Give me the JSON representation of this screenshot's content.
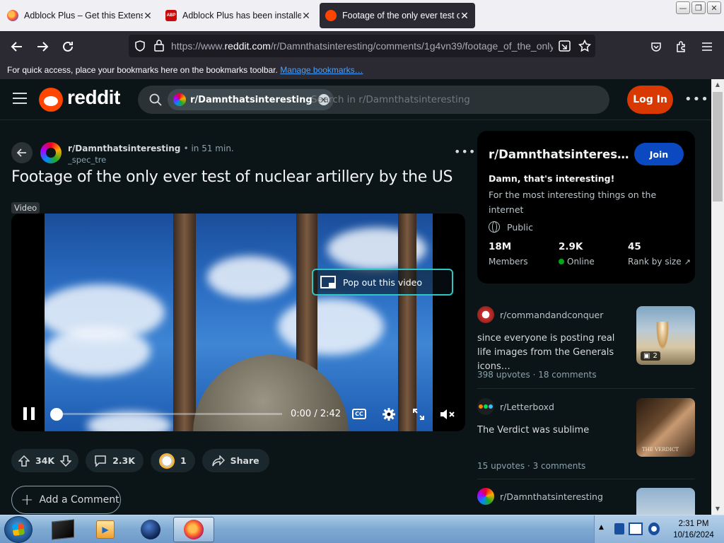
{
  "browser": {
    "tabs": [
      {
        "title": "Adblock Plus – Get this Extensio",
        "favicon": "firefox-icon",
        "active": false
      },
      {
        "title": "Adblock Plus has been installed!",
        "favicon": "abp-icon",
        "active": false
      },
      {
        "title": "Footage of the only ever test of",
        "favicon": "reddit-icon",
        "active": true
      }
    ],
    "favicon_abp_text": "ABP",
    "url_prefix": "https://www.",
    "url_host": "reddit.com",
    "url_path": "/r/Damnthatsinteresting/comments/1g4vn39/footage_of_the_only",
    "bookmarks_text": "For quick access, place your bookmarks here on the bookmarks toolbar.",
    "bookmarks_link": "Manage bookmarks…"
  },
  "reddit_header": {
    "logo_text": "reddit",
    "search_chip": "r/Damnthatsinteresting",
    "search_placeholder": "Search in r/Damnthatsinteresting",
    "login_label": "Log In",
    "more_label": "•••"
  },
  "post": {
    "subreddit": "r/Damnthatsinteresting",
    "time": "• in 51 min.",
    "author": "_spec_tre",
    "title": "Footage of the only ever test of nuclear artillery by the US",
    "flair": "Video",
    "more_label": "•••",
    "video": {
      "popout_label": "Pop out this video",
      "time": "0:00 / 2:42",
      "cc_label": "CC",
      "progress": 0
    },
    "actions": {
      "upvotes": "34K",
      "comments": "2.3K",
      "awards": "1",
      "share": "Share"
    },
    "add_comment": "Add a Comment"
  },
  "sidebar": {
    "title": "r/Damnthatsinteresting",
    "join_label": "Join",
    "tagline": "Damn, that's interesting!",
    "description": "For the most interesting things on the internet",
    "visibility": "Public",
    "stats": [
      {
        "value": "18M",
        "label": "Members"
      },
      {
        "value": "2.9K",
        "label": "Online"
      },
      {
        "value": "45",
        "label": "Rank by size"
      }
    ],
    "related": [
      {
        "subreddit": "r/commandandconquer",
        "title": "since everyone is posting real life images from the Generals icons…",
        "upvotes": "398 upvotes",
        "comments": "18 comments",
        "gallery_count": "2"
      },
      {
        "subreddit": "r/Letterboxd",
        "title": "The Verdict was sublime",
        "upvotes": "15 upvotes",
        "comments": "3 comments",
        "thumb_caption": "THE VERDICT"
      },
      {
        "subreddit": "r/Damnthatsinteresting"
      }
    ],
    "meta_separator": "·"
  },
  "taskbar": {
    "time": "2:31 PM",
    "date": "10/16/2024"
  },
  "colors": {
    "reddit_orange": "#ff4500",
    "login_bg": "#d93900",
    "join_bg": "#0a49c0",
    "page_bg": "#0b1416"
  }
}
